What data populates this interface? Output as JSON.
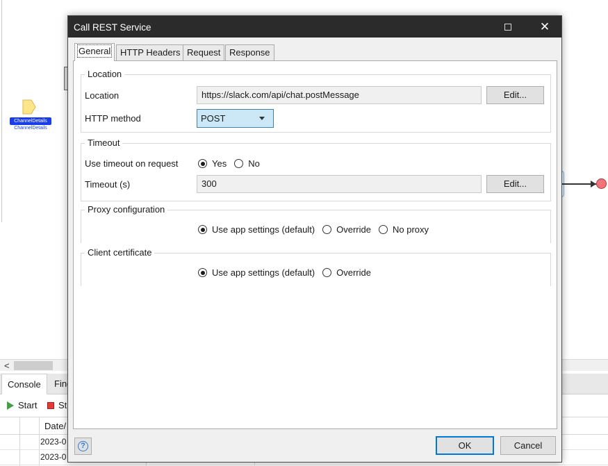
{
  "workspace": {
    "entity_tag": "ChannelDetails",
    "entity_sub": "ChannelDetails",
    "scroll_left_arrow": "<",
    "console": {
      "tabs": [
        "Console",
        "Find"
      ],
      "start_label": "Start",
      "stop_label": "St",
      "column_header": "Date/",
      "rows": [
        "2023-0",
        "2023-0"
      ]
    }
  },
  "dialog": {
    "title": "Call REST Service",
    "close_glyph": "✕",
    "tabs": [
      "General",
      "HTTP Headers",
      "Request",
      "Response"
    ],
    "active_tab": "General",
    "location_group": {
      "legend": "Location",
      "location_label": "Location",
      "location_value": "https://slack.com/api/chat.postMessage",
      "edit_label": "Edit...",
      "method_label": "HTTP method",
      "method_value": "POST"
    },
    "timeout_group": {
      "legend": "Timeout",
      "use_timeout_label": "Use timeout on request",
      "yes_label": "Yes",
      "no_label": "No",
      "selected": "Yes",
      "timeout_label": "Timeout (s)",
      "timeout_value": "300",
      "edit_label": "Edit..."
    },
    "proxy_group": {
      "legend": "Proxy configuration",
      "options": [
        "Use app settings (default)",
        "Override",
        "No proxy"
      ],
      "selected": "Use app settings (default)"
    },
    "cert_group": {
      "legend": "Client certificate",
      "options": [
        "Use app settings (default)",
        "Override"
      ],
      "selected": "Use app settings (default)"
    },
    "help_glyph": "?",
    "ok_label": "OK",
    "cancel_label": "Cancel"
  }
}
